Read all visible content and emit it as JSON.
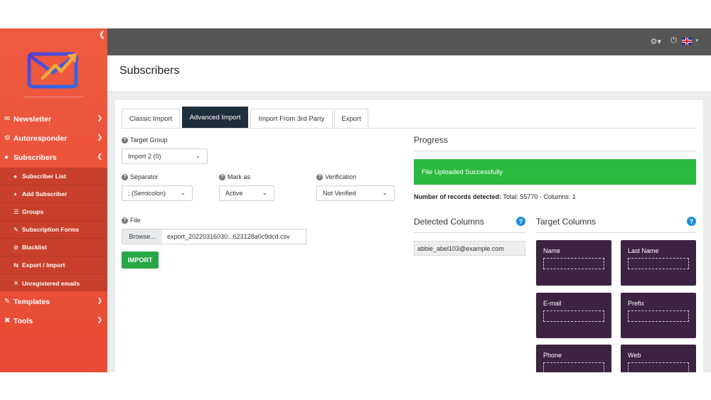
{
  "sidebar": {
    "collapse_icon": "chevron-left-icon",
    "items": [
      {
        "label": "Newsletter",
        "icon": "envelope-icon"
      },
      {
        "label": "Autoresponder",
        "icon": "car-icon"
      },
      {
        "label": "Subscribers",
        "icon": "users-icon"
      },
      {
        "label": "Templates",
        "icon": "paint-roller-icon"
      },
      {
        "label": "Tools",
        "icon": "tools-icon"
      }
    ],
    "subitems": [
      {
        "label": "Subscriber List",
        "icon": "users-icon"
      },
      {
        "label": "Add Subscriber",
        "icon": "plus-icon"
      },
      {
        "label": "Groups",
        "icon": "list-icon"
      },
      {
        "label": "Subscription Forms",
        "icon": "edit-icon"
      },
      {
        "label": "Blacklist",
        "icon": "ban-icon"
      },
      {
        "label": "Export / Import",
        "icon": "exchange-icon"
      },
      {
        "label": "Unregistered emails",
        "icon": "user-slash-icon"
      }
    ]
  },
  "header": {
    "title": "Subscribers"
  },
  "tabs": [
    {
      "label": "Classic Import"
    },
    {
      "label": "Advanced Import"
    },
    {
      "label": "Import From 3rd Party"
    },
    {
      "label": "Export"
    }
  ],
  "form": {
    "target_group_label": "Target Group",
    "target_group_value": "Import 2 (0)",
    "separator_label": "Separator",
    "separator_value": "; (Semicolon)",
    "mark_as_label": "Mark as",
    "mark_as_value": "Active",
    "verification_label": "Verification",
    "verification_value": "Not Verified",
    "file_label": "File",
    "browse_label": "Browse...",
    "file_name": "export_20220316030...623128a0c9dcd.csv",
    "import_label": "IMPORT"
  },
  "progress": {
    "title": "Progress",
    "alert": "File Uploaded Successfully",
    "records_label": "Number of records detected:",
    "records_value": "Total: 55770 - Columns: 1"
  },
  "detected": {
    "title": "Detected Columns",
    "items": [
      "abbie_abel103@example.com"
    ]
  },
  "target": {
    "title": "Target Columns",
    "items": [
      "Name",
      "Last Name",
      "E-mail",
      "Prefix",
      "Phone",
      "Web"
    ]
  },
  "colors": {
    "sidebar": "#e84b35",
    "topbar": "#565656",
    "active_tab": "#1f2e3b",
    "success": "#2bba3f",
    "target_tile": "#3b2341",
    "help": "#1c8ddc"
  }
}
